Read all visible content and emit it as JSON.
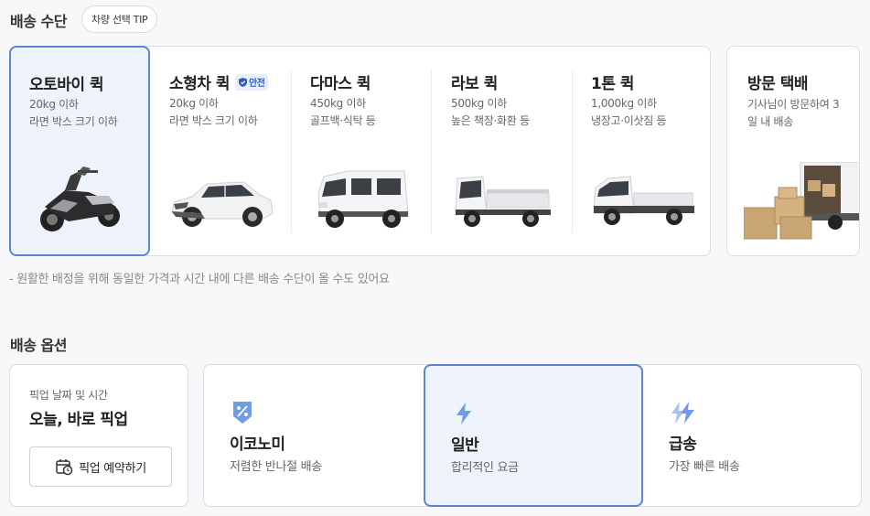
{
  "delivery_method": {
    "title": "배송 수단",
    "tip_label": "차량 선택 TIP",
    "vehicles": [
      {
        "name": "오토바이 퀵",
        "weight": "20kg 이하",
        "desc": "라면 박스 크기 이하",
        "selected": true
      },
      {
        "name": "소형차 퀵",
        "badge": "안전",
        "weight": "20kg 이하",
        "desc": "라면 박스 크기 이하"
      },
      {
        "name": "다마스 퀵",
        "weight": "450kg 이하",
        "desc": "골프백·식탁 등"
      },
      {
        "name": "라보 퀵",
        "weight": "500kg 이하",
        "desc": "높은 책장·화환 등"
      },
      {
        "name": "1톤 퀵",
        "weight": "1,000kg 이하",
        "desc": "냉장고·이삿짐 등"
      }
    ],
    "visit": {
      "name": "방문 택배",
      "desc": "기사님이 방문하여 3일 내 배송"
    },
    "notice": "- 원활한 배정을 위해 동일한 가격과 시간 내에 다른 배송 수단이 올 수도 있어요"
  },
  "delivery_options": {
    "title": "배송 옵션",
    "pickup": {
      "label": "픽업 날짜 및 시간",
      "value": "오늘, 바로 픽업",
      "reserve_label": "픽업 예약하기"
    },
    "options": [
      {
        "name": "이코노미",
        "desc": "저렴한 반나절 배송"
      },
      {
        "name": "일반",
        "desc": "합리적인 요금",
        "selected": true
      },
      {
        "name": "급송",
        "desc": "가장 빠른 배송"
      }
    ]
  },
  "colors": {
    "accent": "#5a86d6",
    "selected_bg": "#edf2fb",
    "icon_blue": "#6f9be8",
    "badge_blue": "#2e5cb8"
  }
}
